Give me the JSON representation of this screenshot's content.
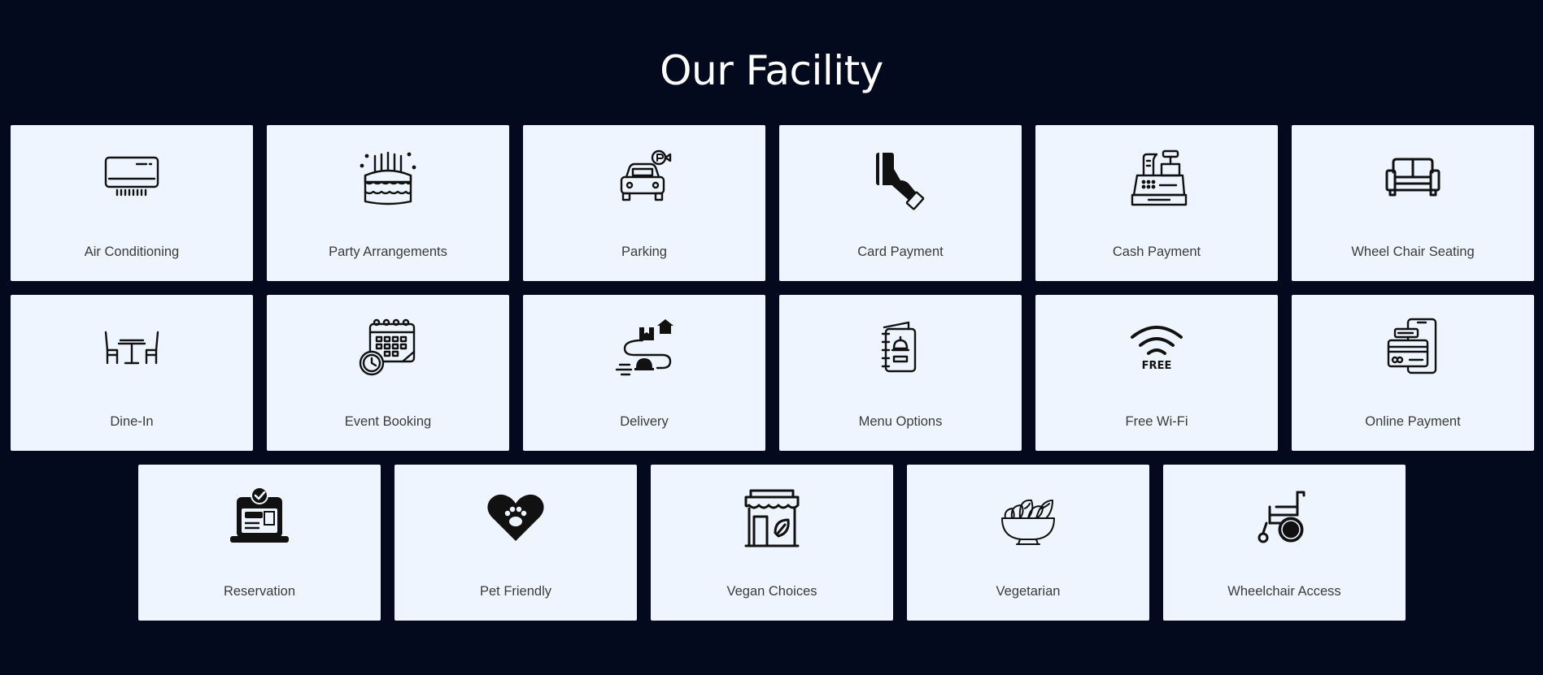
{
  "section": {
    "title": "Our Facility"
  },
  "facilities": [
    {
      "label": "Air Conditioning",
      "icon": "air-conditioner-icon"
    },
    {
      "label": "Party Arrangements",
      "icon": "birthday-cake-icon"
    },
    {
      "label": "Parking",
      "icon": "car-parking-icon"
    },
    {
      "label": "Card Payment",
      "icon": "card-payment-icon"
    },
    {
      "label": "Cash Payment",
      "icon": "cash-register-icon"
    },
    {
      "label": "Wheel Chair Seating",
      "icon": "sofa-icon"
    },
    {
      "label": "Dine-In",
      "icon": "dining-table-icon"
    },
    {
      "label": "Event Booking",
      "icon": "calendar-clock-icon"
    },
    {
      "label": "Delivery",
      "icon": "food-delivery-icon"
    },
    {
      "label": "Menu Options",
      "icon": "menu-book-icon"
    },
    {
      "label": "Free Wi-Fi",
      "icon": "free-wifi-icon",
      "badge": "FREE"
    },
    {
      "label": "Online Payment",
      "icon": "online-payment-icon"
    },
    {
      "label": "Reservation",
      "icon": "laptop-reservation-icon"
    },
    {
      "label": "Pet Friendly",
      "icon": "heart-paw-icon"
    },
    {
      "label": "Vegan Choices",
      "icon": "vegan-store-icon"
    },
    {
      "label": "Vegetarian",
      "icon": "salad-bowl-icon"
    },
    {
      "label": "Wheelchair Access",
      "icon": "wheelchair-icon"
    }
  ],
  "colors": {
    "background": "#030a1e",
    "card": "#eef5fe",
    "title": "#ffffff",
    "label": "#3b3b3b",
    "icon": "#111111"
  }
}
